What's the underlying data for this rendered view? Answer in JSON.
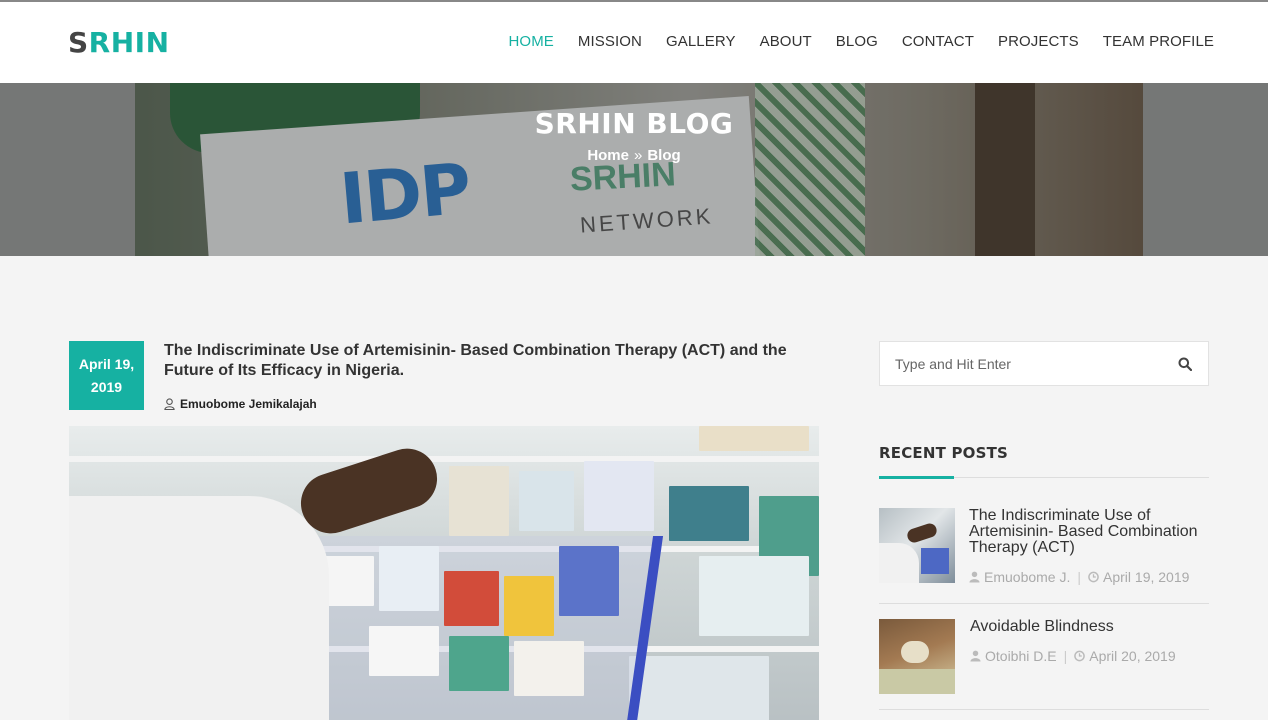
{
  "header": {
    "logo_first": "S",
    "logo_rest": "RHIN",
    "nav": [
      "HOME",
      "MISSION",
      "GALLERY",
      "ABOUT",
      "BLOG",
      "CONTACT",
      "PROJECTS",
      "TEAM PROFILE"
    ],
    "active_nav": "HOME"
  },
  "hero": {
    "title": "SRHIN BLOG",
    "breadcrumb_home": "Home",
    "breadcrumb_sep": "»",
    "breadcrumb_current": "Blog",
    "image_text": {
      "idp": "IDP",
      "srhin": "SRHIN",
      "network": "NETWORK"
    }
  },
  "post": {
    "date_line1": "April 19,",
    "date_line2": "2019",
    "title": "The Indiscriminate Use of Artemisinin- Based Combination Therapy (ACT) and the Future of Its Efficacy in Nigeria.",
    "author": "Emuobome Jemikalajah"
  },
  "sidebar": {
    "search_placeholder": "Type and Hit Enter",
    "recent_title": "RECENT POSTS",
    "recent_posts": [
      {
        "title": "The Indiscriminate Use of Artemisinin- Based Combination Therapy (ACT)",
        "author": "Emuobome J.",
        "date": "April 19, 2019"
      },
      {
        "title": "Avoidable Blindness",
        "author": "Otoibhi D.E",
        "date": "April 20, 2019"
      }
    ]
  },
  "colors": {
    "accent": "#16b1a2",
    "text": "#333333",
    "background": "#f4f4f4"
  },
  "icons": {
    "author": "user-icon",
    "search": "search-icon",
    "date": "clock-icon"
  }
}
